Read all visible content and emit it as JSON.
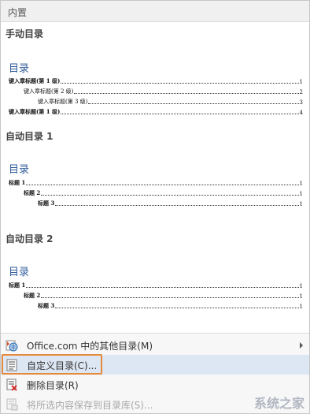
{
  "header": {
    "title": "内置"
  },
  "gallery": [
    {
      "title": "手动目录",
      "toc_heading": "目录",
      "entries": [
        {
          "text": "键入章标题(第 1 级)",
          "page": "1",
          "level": 1
        },
        {
          "text": "键入章标题(第 2 级)",
          "page": "2",
          "level": 2
        },
        {
          "text": "键入章标题(第 3 级)",
          "page": "3",
          "level": 3
        },
        {
          "text": "键入章标题(第 1 级)",
          "page": "4",
          "level": 1
        }
      ]
    },
    {
      "title": "自动目录 1",
      "toc_heading": "目录",
      "entries": [
        {
          "text": "标题 1",
          "page": "1",
          "level": 1
        },
        {
          "text": "标题 2",
          "page": "1",
          "level": 2
        },
        {
          "text": "标题 3",
          "page": "1",
          "level": 3
        }
      ]
    },
    {
      "title": "自动目录 2",
      "toc_heading": "目录",
      "entries": [
        {
          "text": "标题 1",
          "page": "1",
          "level": 1
        },
        {
          "text": "标题 2",
          "page": "1",
          "level": 2
        },
        {
          "text": "标题 3",
          "page": "1",
          "level": 3
        }
      ]
    }
  ],
  "menu": {
    "more_from_office": "Office.com 中的其他目录(M)",
    "custom_toc": "自定义目录(C)...",
    "remove_toc": "删除目录(R)",
    "save_selection": "将所选内容保存到目录库(S)..."
  },
  "watermark": "系统之家",
  "colors": {
    "toc_heading": "#2e5a9a",
    "selected_bg": "#dde6f3",
    "highlight_border": "#e58a3a"
  }
}
